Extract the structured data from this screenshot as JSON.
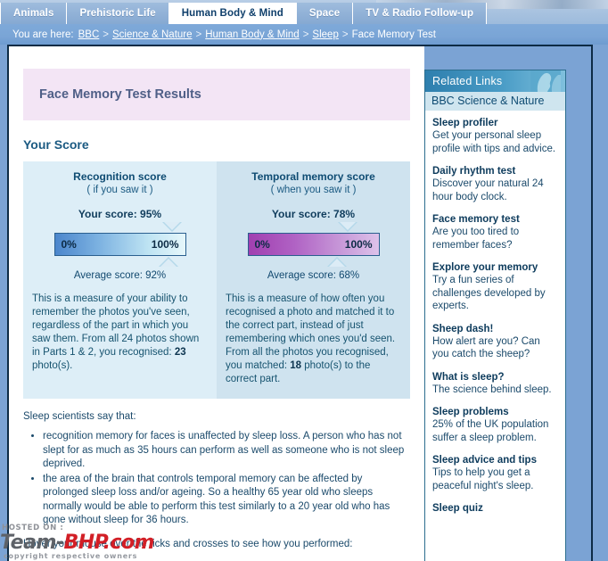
{
  "nav": {
    "tabs": [
      {
        "label": "Animals",
        "active": false
      },
      {
        "label": "Prehistoric Life",
        "active": false
      },
      {
        "label": "Human Body & Mind",
        "active": true
      },
      {
        "label": "Space",
        "active": false
      },
      {
        "label": "TV & Radio Follow-up",
        "active": false
      }
    ]
  },
  "breadcrumb": {
    "prefix": "You are here:",
    "items": [
      {
        "label": "BBC",
        "link": true
      },
      {
        "label": "Science & Nature",
        "link": true
      },
      {
        "label": "Human Body & Mind",
        "link": true
      },
      {
        "label": "Sleep",
        "link": true
      },
      {
        "label": "Face Memory Test",
        "link": false
      }
    ],
    "separator": ">"
  },
  "main": {
    "banner_title": "Face Memory Test Results",
    "section_heading": "Your Score",
    "panels": [
      {
        "title": "Recognition score",
        "subtitle": "( if you saw it )",
        "your_score_label": "Your score: 95%",
        "scale_min": "0%",
        "scale_max": "100%",
        "average_label": "Average score: 92%",
        "description_before": "This is a measure of your ability to remember the photos you've seen, regardless of the part in which you saw them. From all 24 photos shown in Parts 1 & 2, you recognised: ",
        "description_bold": "23",
        "description_after": " photo(s).",
        "your_score_value": 95,
        "average_value": 92
      },
      {
        "title": "Temporal memory score",
        "subtitle": "( when you saw it )",
        "your_score_label": "Your score: 78%",
        "scale_min": "0%",
        "scale_max": "100%",
        "average_label": "Average score: 68%",
        "description_before": "This is a measure of how often you recognised a photo and matched it to the correct part, instead of just remembering which ones you'd seen. From all the photos you recognised, you matched: ",
        "description_bold": "18",
        "description_after": " photo(s) to the correct part.",
        "your_score_value": 78,
        "average_value": 68
      }
    ],
    "says_intro": "Sleep scientists say that:",
    "facts": [
      "recognition memory for faces is unaffected by sleep loss. A person who has not slept for as much as 35 hours can perform as well as someone who is not sleep deprived.",
      "the area of the brain that controls temporal memory can be affected by prolonged sleep loss and/or ageing. So a healthy 65 year old who sleeps normally would be able to perform this test similarly to a 20 year old who has gone without sleep for 36 hours."
    ],
    "hover_note": "Hover your mouse over the ticks and crosses to see how you performed:"
  },
  "sidebar": {
    "header_title": "Related Links",
    "subheader": "BBC Science & Nature",
    "links": [
      {
        "title": "Sleep profiler",
        "desc": "Get your personal sleep profile with tips and advice."
      },
      {
        "title": "Daily rhythm test",
        "desc": "Discover your natural 24 hour body clock."
      },
      {
        "title": "Face memory test",
        "desc": "Are you too tired to remember faces?"
      },
      {
        "title": "Explore your memory",
        "desc": "Try a fun series of challenges developed by experts."
      },
      {
        "title": "Sheep dash!",
        "desc": "How alert are you? Can you catch the sheep?"
      },
      {
        "title": "What is sleep?",
        "desc": "The science behind sleep."
      },
      {
        "title": "Sleep problems",
        "desc": "25% of the UK population suffer a sleep problem."
      },
      {
        "title": "Sleep advice and tips",
        "desc": "Tips to help you get a peaceful night's sleep."
      },
      {
        "title": "Sleep quiz",
        "desc": ""
      }
    ]
  },
  "watermark": {
    "hosted_on": "HOSTED ON :",
    "name_first": "Team-",
    "name_second": "BHP.com",
    "footer": "copyright respective owners"
  },
  "colors": {
    "page_bg": "#7ba3d4",
    "tab_active_bg": "#ffffff",
    "tab_inactive_bg": "#8fb0d6",
    "breadcrumb_bg": "#7aa5d6",
    "banner_bg": "#f3e5f5",
    "panel_left_bg": "#ddeef7",
    "panel_right_bg": "#cfe3ef",
    "gauge_blue_start": "#4b86cc",
    "gauge_blue_end": "#e6f7fb",
    "gauge_purple_start": "#a13fb0",
    "gauge_purple_end": "#ddc2ea",
    "sidebar_header": "#2e7fae",
    "text_primary": "#1b4a6b",
    "watermark_red": "#d21f26"
  }
}
